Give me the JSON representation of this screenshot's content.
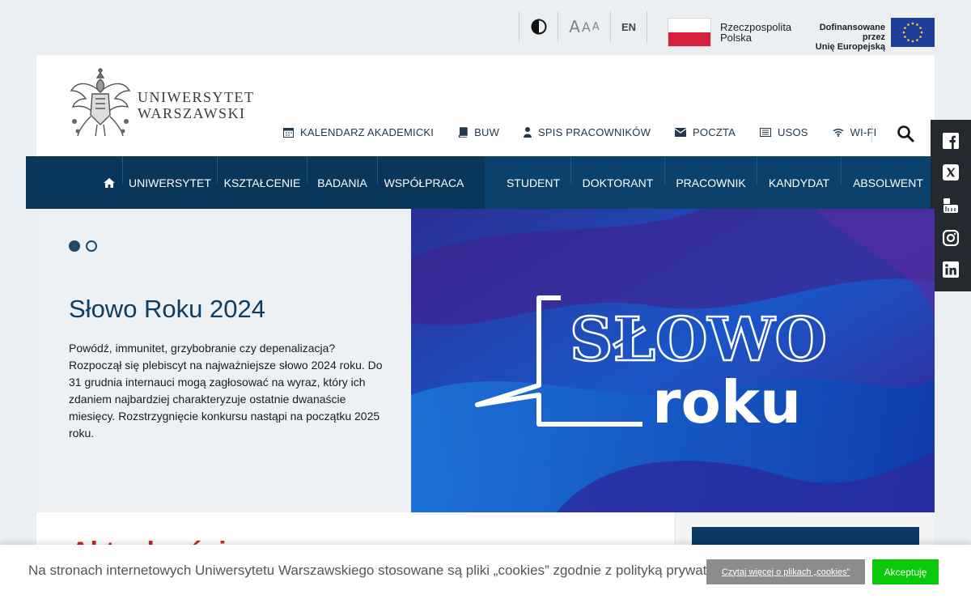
{
  "topbar": {
    "contrast_icon": "contrast-icon",
    "font_sizes": [
      "A",
      "A",
      "A"
    ],
    "lang": "EN",
    "pl_line1": "Rzeczpospolita",
    "pl_line2": "Polska",
    "eu_line1": "Dofinansowane przez",
    "eu_line2": "Unię Europejską"
  },
  "logo": {
    "line1": "UNIWERSYTET",
    "line2": "WARSZAWSKI"
  },
  "quicklinks": [
    {
      "label": "KALENDARZ AKADEMICKI",
      "icon": "calendar-icon"
    },
    {
      "label": "BUW",
      "icon": "book-icon"
    },
    {
      "label": "SPIS PRACOWNIKÓW",
      "icon": "person-icon"
    },
    {
      "label": "POCZTA",
      "icon": "envelope-icon"
    },
    {
      "label": "USOS",
      "icon": "list-icon"
    },
    {
      "label": "WI-FI",
      "icon": "wifi-icon"
    }
  ],
  "mainnav": {
    "home_icon": "home-icon",
    "left": [
      "UNIWERSYTET",
      "KSZTAŁCENIE",
      "BADANIA",
      "WSPÓŁPRACA"
    ],
    "right": [
      "STUDENT",
      "DOKTORANT",
      "PRACOWNIK",
      "KANDYDAT",
      "ABSOLWENT"
    ]
  },
  "social": [
    "facebook-icon",
    "x-icon",
    "youtube-icon",
    "instagram-icon",
    "linkedin-icon"
  ],
  "hero": {
    "slides_total": 2,
    "active_slide": 1,
    "title": "Słowo Roku 2024",
    "text": "Powódź, immunitet, grzybobranie czy depenalizacja? Rozpoczął się plebiscyt na najważniejsze słowo 2024 roku. Do 31 grudnia internauci mogą zagłosować na wyraz, który ich zdaniem najbardziej charakteryzuje ostatnie dwanaście miesięcy. Rozstrzygnięcie konkursu nastąpi na początku 2025 roku.",
    "image_word1": "SŁOWO",
    "image_word2": "roku"
  },
  "content": {
    "heading": "Aktualności"
  },
  "cookie": {
    "text": "Na stronach internetowych Uniwersytetu Warszawskiego stosowane są pliki „cookies” zgodnie z polityką prywatności.",
    "more": "Czytaj więcej o plikach „cookies”",
    "accept": "Akceptuję"
  },
  "colors": {
    "nav_dark": "#08375a",
    "nav_right": "#0b416b",
    "heading_red": "#c7242b",
    "accept_green": "#09c909"
  }
}
